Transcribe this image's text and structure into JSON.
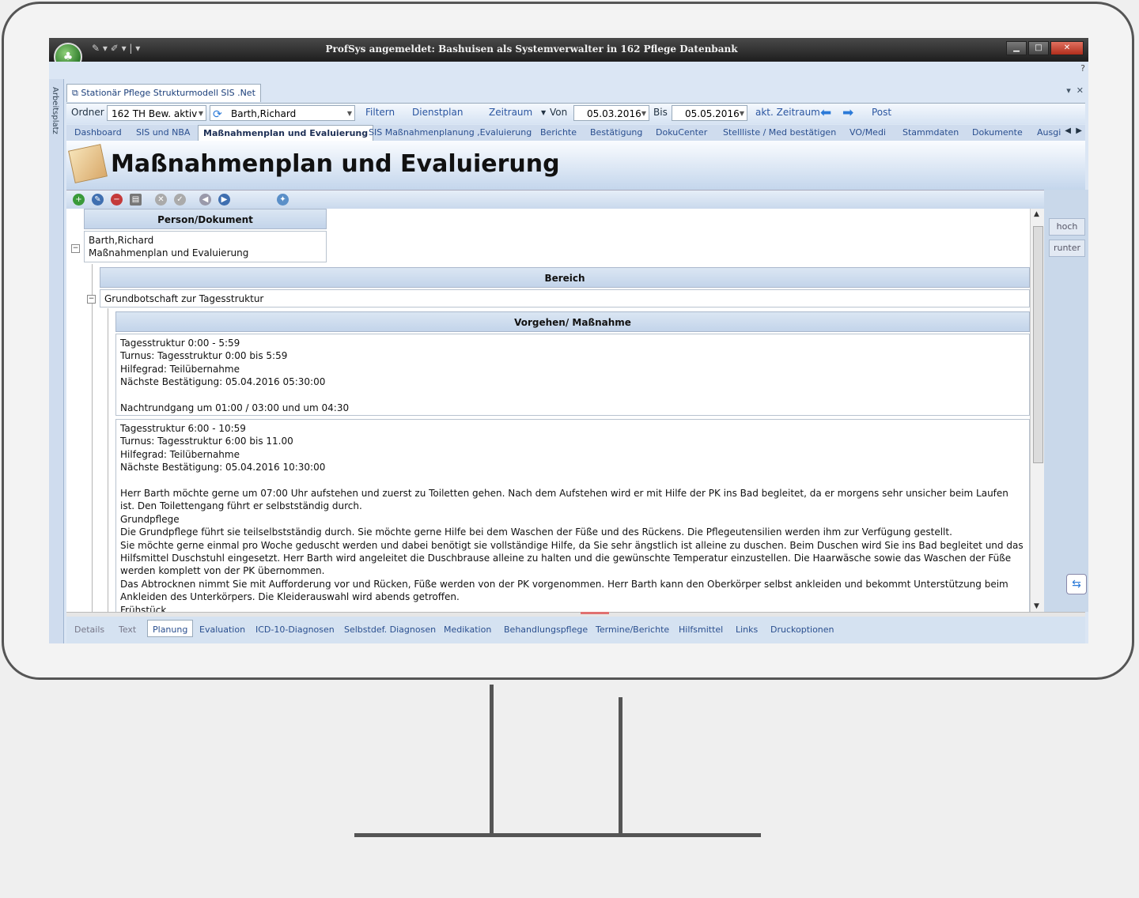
{
  "window": {
    "title": "ProfSys angemeldet: Bashuisen als Systemverwalter in 162 Pflege Datenbank",
    "help": "?",
    "side_label": "Arbeitsplatz"
  },
  "doc_tab": {
    "label": "Stationär Pflege Strukturmodell SIS .Net"
  },
  "toolbar": {
    "ordner_label": "Ordner",
    "ordner_value": "162 TH Bew. aktiv",
    "person_value": "Barth,Richard",
    "filtern": "Filtern",
    "dienstplan": "Dienstplan",
    "zeitraum": "Zeitraum",
    "von": "Von",
    "von_date": "05.03.2016",
    "bis": "Bis",
    "bis_date": "05.05.2016",
    "akt_zeitraum": "akt. Zeitraum",
    "post": "Post"
  },
  "ribbon": {
    "tabs": [
      "Dashboard",
      "SIS und NBA",
      "Maßnahmenplan und Evaluierung",
      "SIS Maßnahmenplanung ,Evaluierung",
      "Berichte",
      "Bestätigung",
      "DokuCenter",
      "Stellliste / Med bestätigen",
      "VO/Medi",
      "Stammdaten",
      "Dokumente",
      "Ausgi"
    ]
  },
  "page": {
    "title": "Maßnahmenplan und Evaluierung"
  },
  "grid": {
    "person_header": "Person/Dokument",
    "person_lines": [
      "Barth,Richard",
      "Maßnahmenplan und Evaluierung"
    ],
    "bereich_header": "Bereich",
    "bereich_value": "Grundbotschaft zur Tagesstruktur",
    "vorgehen_header": "Vorgehen/ Maßnahme",
    "entry1": [
      "Tagesstruktur 0:00 - 5:59",
      "Turnus: Tagesstruktur 0:00 bis 5:59",
      "Hilfegrad:  Teilübernahme",
      "Nächste Bestätigung: 05.04.2016 05:30:00",
      "",
      "Nachtrundgang um 01:00 / 03:00 und um 04:30"
    ],
    "entry2": [
      "Tagesstruktur 6:00 - 10:59",
      "Turnus: Tagesstruktur 6:00 bis 11.00",
      "Hilfegrad:  Teilübernahme",
      "Nächste Bestätigung: 05.04.2016 10:30:00",
      "",
      "Herr Barth möchte gerne um 07:00 Uhr aufstehen und zuerst zu Toiletten gehen. Nach dem Aufstehen wird er mit Hilfe der PK ins Bad begleitet, da er morgens sehr unsicher beim Laufen ist. Den Toilettengang führt er selbstständig durch.",
      "Grundpflege",
      "Die Grundpflege führt sie teilselbstständig durch. Sie möchte gerne Hilfe bei dem Waschen der Füße und des Rückens. Die Pflegeutensilien werden ihm zur Verfügung gestellt.",
      "Sie möchte gerne einmal pro Woche geduscht werden und dabei benötigt sie vollständige Hilfe, da Sie sehr ängstlich ist alleine zu duschen. Beim Duschen wird Sie ins Bad begleitet und das Hilfsmittel Duschstuhl eingesetzt. Herr Barth wird angeleitet die Duschbrause alleine zu halten und die gewünschte Temperatur einzustellen. Die Haarwäsche sowie das Waschen der Füße werden komplett von der PK übernommen.",
      "Das Abtrocknen nimmt Sie mit Aufforderung vor und Rücken, Füße werden von der PK vorgenommen. Herr Barth kann den Oberkörper selbst ankleiden und bekommt Unterstützung beim Ankleiden des Unterkörpers. Die Kleiderauswahl wird abends getroffen.",
      "Frühstück"
    ]
  },
  "right_panel": {
    "hoch": "hoch",
    "runter": "runter"
  },
  "bottom_tabs": [
    "Details",
    "Text",
    "Planung",
    "Evaluation",
    "ICD-10-Diagnosen",
    "Selbstdef. Diagnosen",
    "Medikation",
    "Behandlungspflege",
    "Termine/Berichte",
    "Hilfsmittel",
    "Links",
    "Druckoptionen"
  ],
  "colors": {
    "accent_blue": "#2b7ad8",
    "link_blue": "#2a4f8f",
    "header_bg": "#c3d4ea"
  },
  "icons": [
    "add-icon",
    "edit-icon",
    "delete-icon",
    "print-icon",
    "cancel-icon",
    "confirm-icon",
    "back-icon",
    "forward-icon",
    "globe-icon",
    "teamviewer-icon"
  ]
}
